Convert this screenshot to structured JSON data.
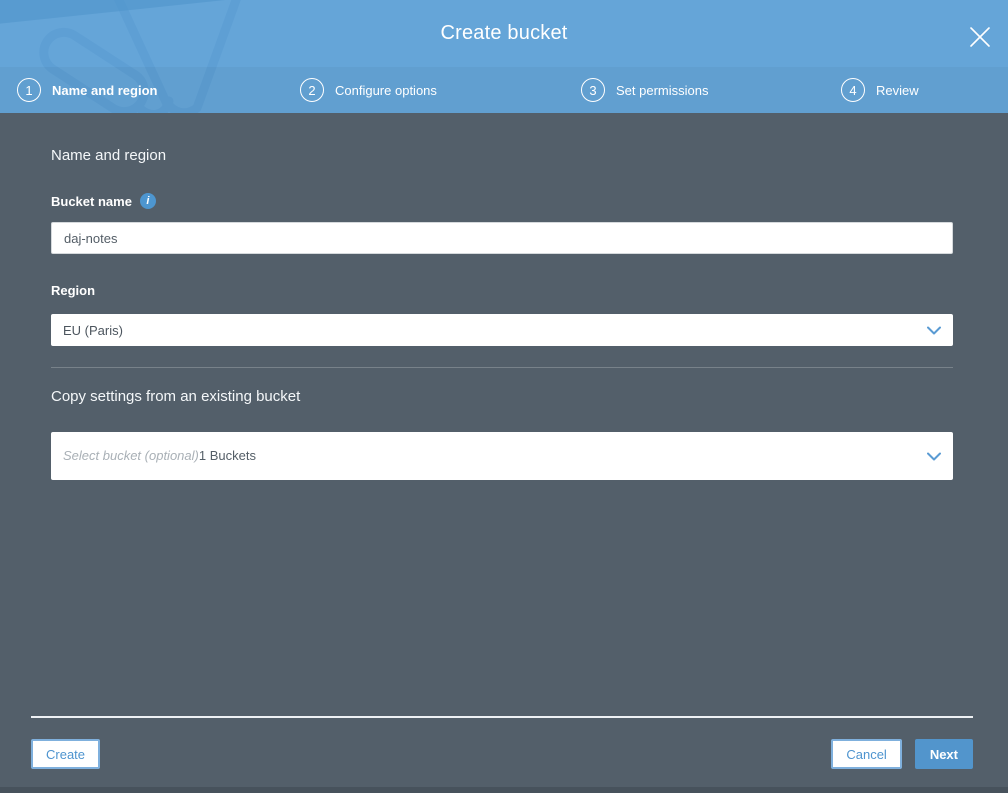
{
  "header": {
    "title": "Create bucket",
    "steps": [
      {
        "number": "1",
        "label": "Name and region",
        "active": true
      },
      {
        "number": "2",
        "label": "Configure options",
        "active": false
      },
      {
        "number": "3",
        "label": "Set permissions",
        "active": false
      },
      {
        "number": "4",
        "label": "Review",
        "active": false
      }
    ]
  },
  "form": {
    "section_title": "Name and region",
    "bucket_name": {
      "label": "Bucket name",
      "value": "daj-notes"
    },
    "region": {
      "label": "Region",
      "selected": "EU (Paris)"
    },
    "copy_settings": {
      "section_title": "Copy settings from an existing bucket",
      "placeholder": "Select bucket (optional)",
      "bucket_count": "1 Buckets"
    }
  },
  "footer": {
    "create_label": "Create",
    "cancel_label": "Cancel",
    "next_label": "Next"
  },
  "icons": {
    "info_glyph": "i",
    "info_icon": "info-icon",
    "close_icon": "close-icon",
    "chevron_down_icon": "chevron-down-icon",
    "bucket_watermark": "s3-bucket-watermark"
  },
  "colors": {
    "header_blue": "#65a5d8",
    "body_slate": "#535f6a",
    "accent_blue": "#4e94cf",
    "primary_button_blue": "#5295cc",
    "info_icon_blue": "#4d96d0",
    "bottom_strip": "#47525c"
  }
}
